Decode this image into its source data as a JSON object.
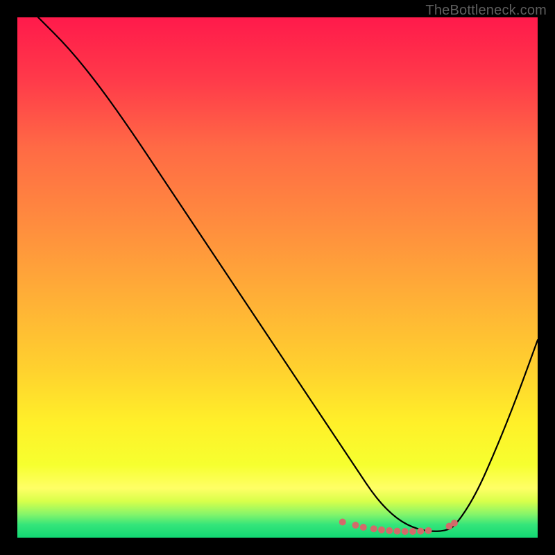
{
  "watermark": "TheBottleneck.com",
  "chart_data": {
    "type": "line",
    "title": "",
    "xlabel": "",
    "ylabel": "",
    "xlim": [
      0,
      100
    ],
    "ylim": [
      0,
      100
    ],
    "grid": false,
    "legend": false,
    "gradient_stops": [
      {
        "offset": 0.0,
        "color": "#ff1a4b"
      },
      {
        "offset": 0.12,
        "color": "#ff3a4a"
      },
      {
        "offset": 0.25,
        "color": "#ff6a45"
      },
      {
        "offset": 0.4,
        "color": "#ff8d3e"
      },
      {
        "offset": 0.55,
        "color": "#ffb236"
      },
      {
        "offset": 0.68,
        "color": "#ffd22e"
      },
      {
        "offset": 0.78,
        "color": "#fff029"
      },
      {
        "offset": 0.86,
        "color": "#f6ff2f"
      },
      {
        "offset": 0.905,
        "color": "#ffff66"
      },
      {
        "offset": 0.93,
        "color": "#d8ff4a"
      },
      {
        "offset": 0.955,
        "color": "#86f56a"
      },
      {
        "offset": 0.975,
        "color": "#35e57a"
      },
      {
        "offset": 1.0,
        "color": "#12d873"
      }
    ],
    "series": [
      {
        "name": "bottleneck-curve",
        "color": "#000000",
        "x": [
          4,
          10,
          16,
          22,
          28,
          34,
          40,
          46,
          52,
          58,
          62,
          66,
          68,
          70,
          72,
          74,
          76,
          78,
          80,
          82,
          84,
          88,
          92,
          96,
          100
        ],
        "y": [
          100,
          94,
          86.5,
          78,
          69,
          60,
          51,
          42,
          33,
          24,
          18,
          12,
          9,
          6.5,
          4.5,
          3,
          2,
          1.4,
          1.2,
          1.3,
          2,
          8,
          17,
          27,
          38
        ]
      }
    ],
    "markers": {
      "name": "bottom-dots",
      "color": "#d46a6a",
      "radius_px": 5,
      "x": [
        62.5,
        65.0,
        66.5,
        68.5,
        70.0,
        71.5,
        73.0,
        74.5,
        76.0,
        77.5,
        79.0,
        83.0,
        84.0
      ],
      "y": [
        3.0,
        2.4,
        2.0,
        1.7,
        1.5,
        1.35,
        1.25,
        1.2,
        1.2,
        1.25,
        1.35,
        2.2,
        2.8
      ]
    }
  }
}
